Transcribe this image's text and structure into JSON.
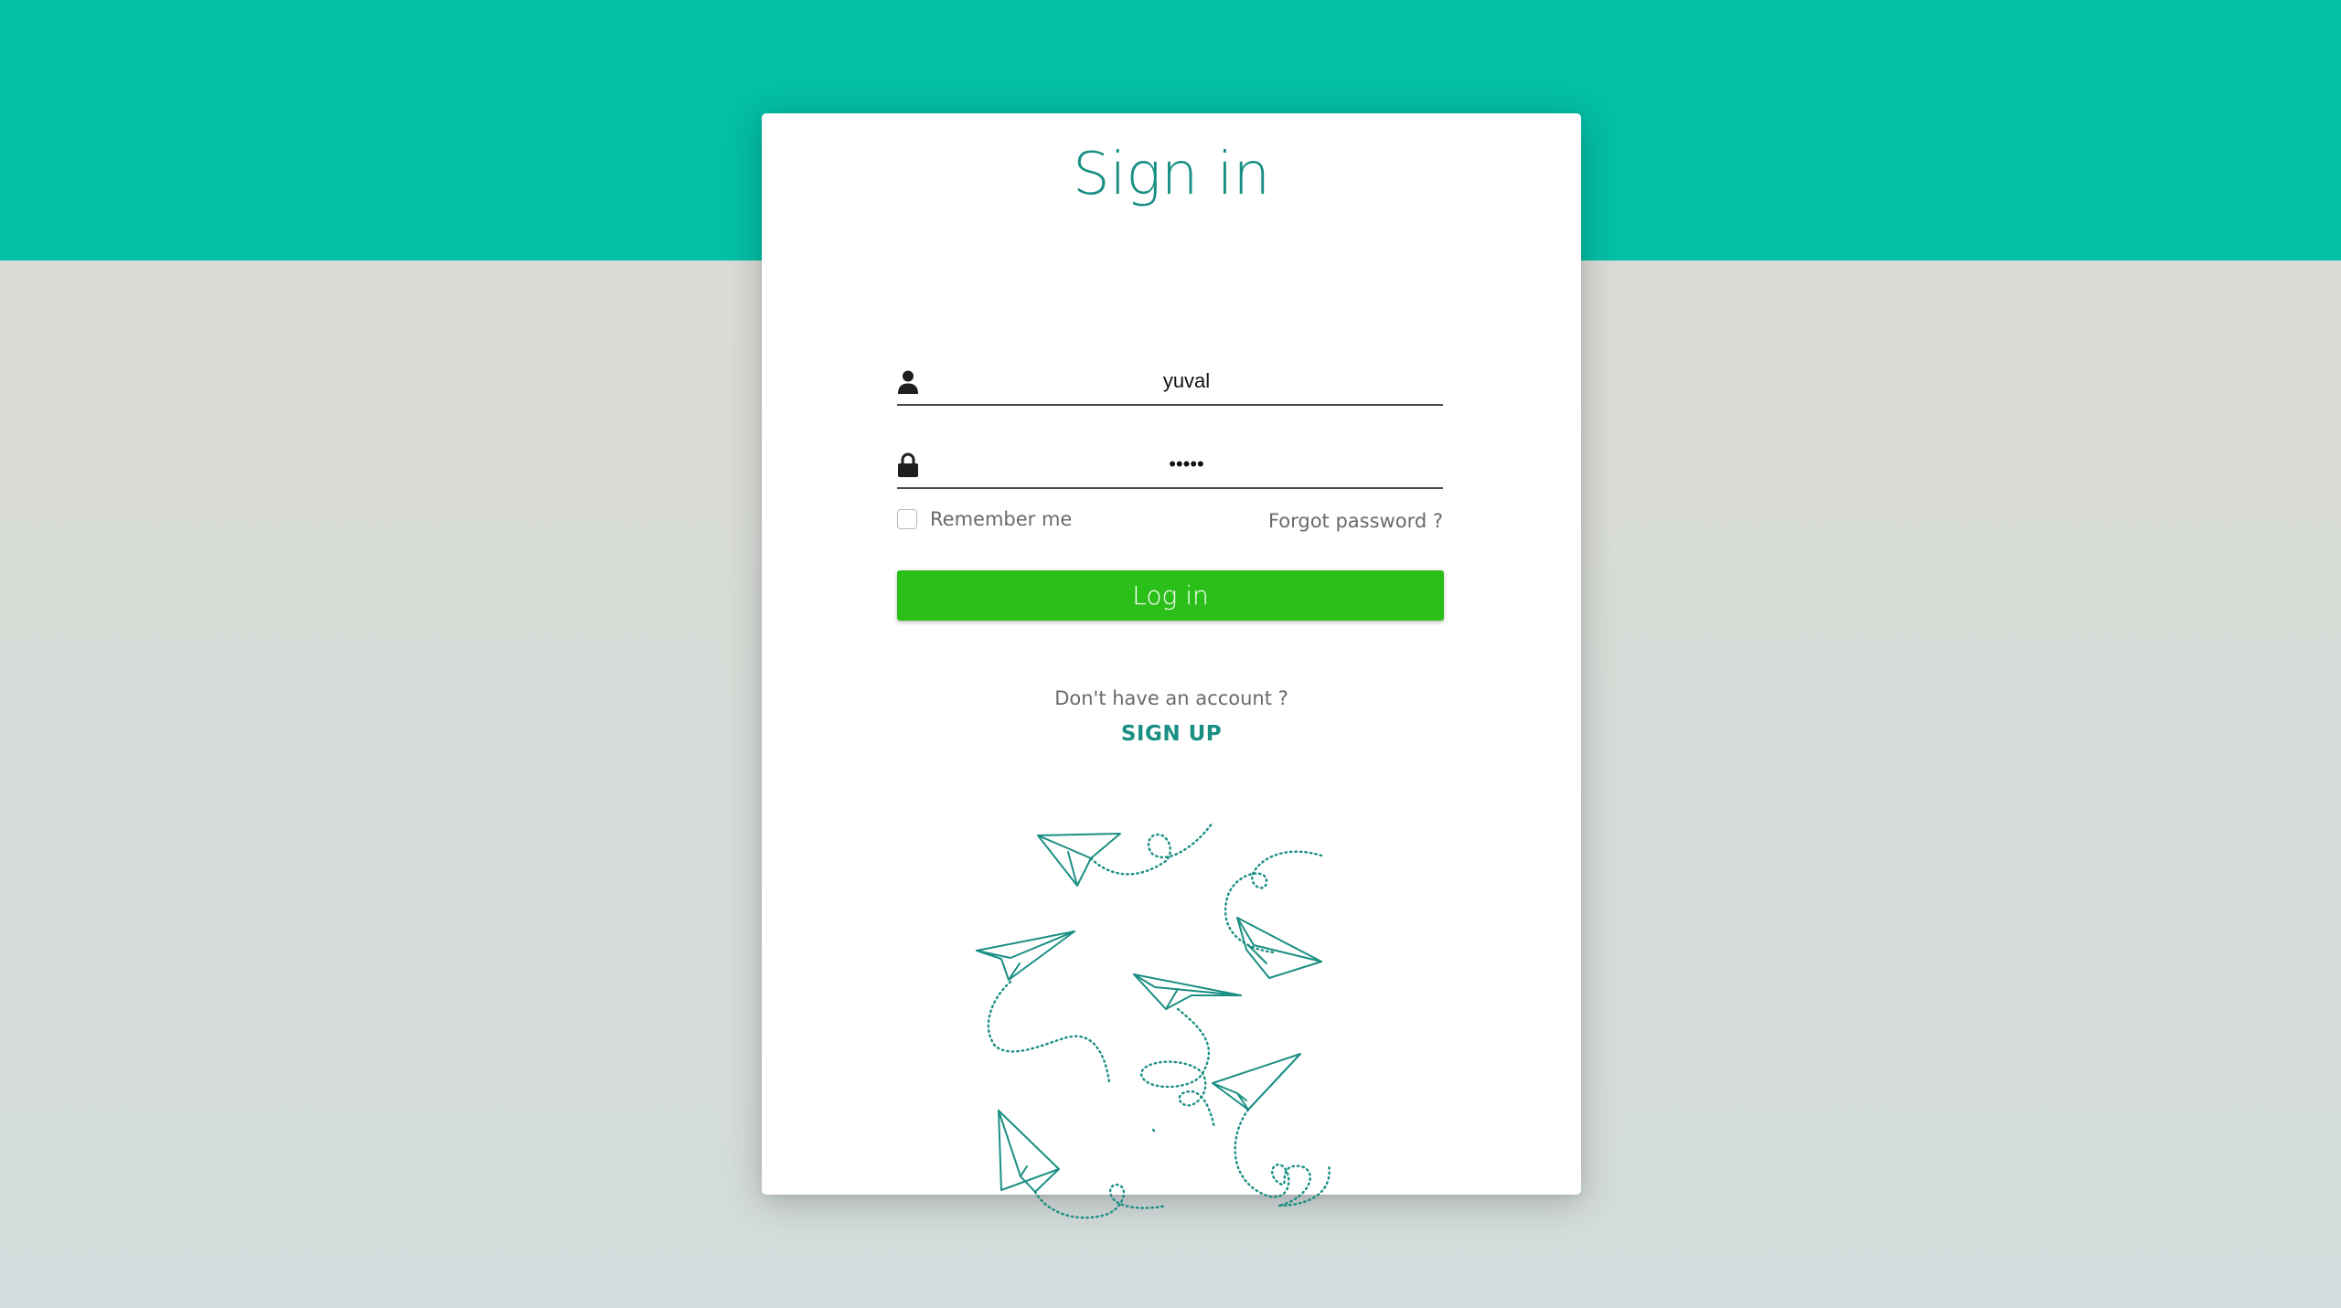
{
  "colors": {
    "accent": "#04bea6",
    "title": "#1a8f83",
    "login_button": "#2bbf19",
    "illustration_stroke": "#1a8f83"
  },
  "login": {
    "title": "Sign in",
    "username_value": "yuval",
    "password_value": "yuval",
    "remember_label": "Remember me",
    "remember_checked": false,
    "forgot_label": "Forgot password ?",
    "login_label": "Log in",
    "no_account_text": "Don't have an account ?",
    "signup_label": "SIGN UP"
  },
  "icons": {
    "username": "user-icon",
    "password": "lock-icon",
    "illustration": "paper-planes-illustration"
  }
}
